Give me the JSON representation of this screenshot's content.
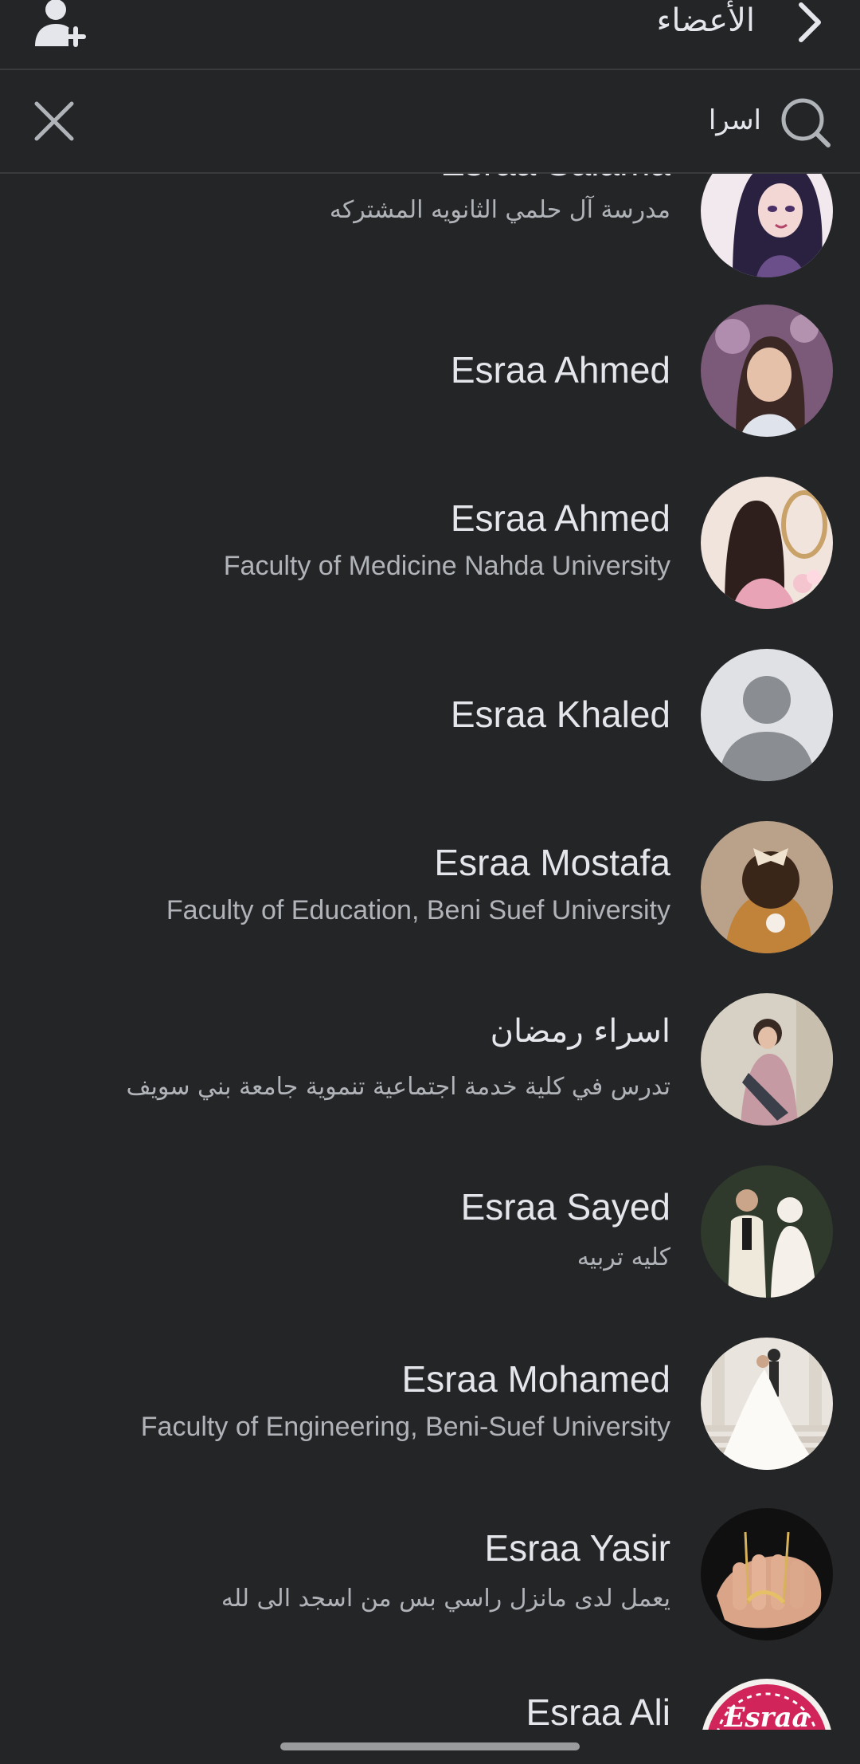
{
  "header": {
    "title": "الأعضاء",
    "add_member_icon": "person-add-icon",
    "back_icon": "chevron-right-icon"
  },
  "search": {
    "query": "اسرا",
    "search_icon": "search-icon",
    "clear_icon": "close-icon"
  },
  "members": [
    {
      "name": "Esraa Salama",
      "subtitle": "مدرسة آل حلمي الثانويه المشتركه",
      "avatar": "avatar-cartoon-girl"
    },
    {
      "name": "Esraa Ahmed",
      "subtitle": "",
      "avatar": "avatar-woman-portrait"
    },
    {
      "name": "Esraa Ahmed",
      "subtitle": "Faculty of Medicine Nahda University",
      "avatar": "avatar-woman-pink-dress"
    },
    {
      "name": "Esraa Khaled",
      "subtitle": "",
      "avatar": "default-profile-icon"
    },
    {
      "name": "Esraa Mostafa",
      "subtitle": "Faculty of Education, Beni Suef University",
      "avatar": "avatar-child-with-bow"
    },
    {
      "name": "اسراء رمضان",
      "subtitle": "تدرس في كلية خدمة اجتماعية تنموية جامعة بني سويف",
      "avatar": "avatar-girl-with-bouquet"
    },
    {
      "name": "Esraa Sayed",
      "subtitle": "كليه تربيه",
      "avatar": "avatar-wedding-couple"
    },
    {
      "name": "Esraa Mohamed",
      "subtitle": "Faculty of Engineering, Beni-Suef University",
      "avatar": "avatar-bride-on-stairs"
    },
    {
      "name": "Esraa Yasir",
      "subtitle": "يعمل لدى مانزل راسي بس من اسجد الى لله",
      "avatar": "avatar-hand-with-name-necklace"
    },
    {
      "name": "Esraa Ali",
      "subtitle": "",
      "avatar": "avatar-esraa-logo",
      "avatar_text": "Esraa"
    }
  ],
  "colors": {
    "background": "#242527",
    "primary_text": "#e4e6eb",
    "secondary_text": "#b0b3b8",
    "divider": "#3a3b3c"
  }
}
